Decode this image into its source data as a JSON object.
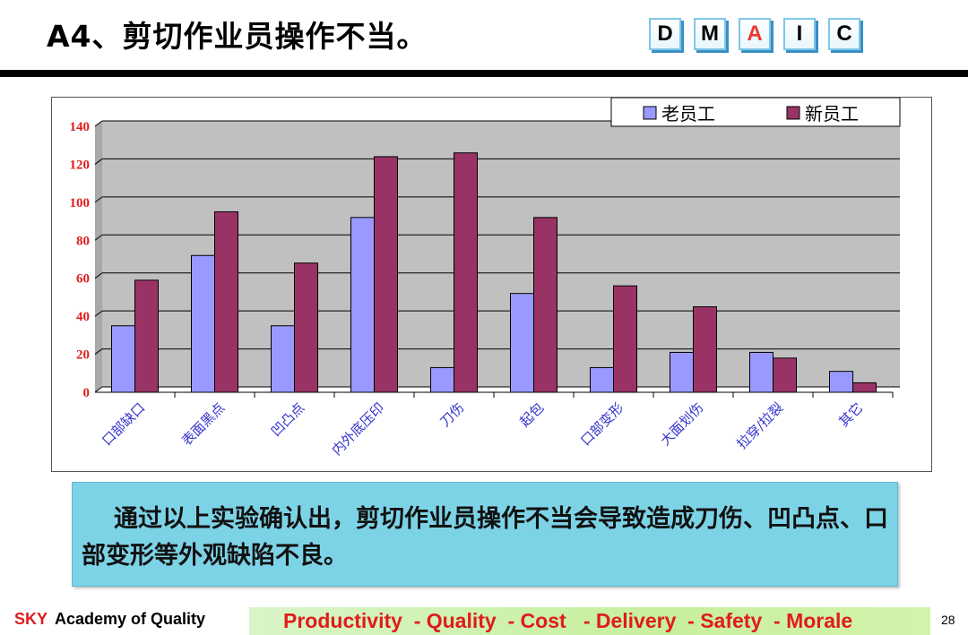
{
  "slide": {
    "title": "A4、剪切作业员操作不当。",
    "dmaic": [
      {
        "letter": "D",
        "active": false
      },
      {
        "letter": "M",
        "active": false
      },
      {
        "letter": "A",
        "active": true
      },
      {
        "letter": "I",
        "active": false
      },
      {
        "letter": "C",
        "active": false
      }
    ],
    "conclusion": "通过以上实验确认出，剪切作业员操作不当会导致造成刀伤、凹凸点、口部变形等外观缺陷不良。",
    "footer": {
      "brand_prefix": "SKY",
      "brand_name": "Academy of Quality",
      "motto": "Productivity  - Quality  - Cost   - Delivery  - Safety  - Morale",
      "page": "28"
    }
  },
  "colors": {
    "old_staff": "#9999ff",
    "new_staff": "#993366",
    "plot_bg": "#c0c0c0",
    "tick_label": "#e01c1c",
    "category_label": "#3333cc",
    "dmaic_active": "#e8392b"
  },
  "chart_data": {
    "type": "bar",
    "categories": [
      "口部缺口",
      "表面黑点",
      "凹凸点",
      "内外底压印",
      "刀伤",
      "起包",
      "口部变形",
      "大面划伤",
      "拉穿/拉裂",
      "其它"
    ],
    "series": [
      {
        "name": "老员工",
        "values": [
          35,
          72,
          35,
          92,
          13,
          52,
          13,
          21,
          21,
          11
        ]
      },
      {
        "name": "新员工",
        "values": [
          59,
          95,
          68,
          124,
          126,
          92,
          56,
          45,
          18,
          5
        ]
      }
    ],
    "ylim": [
      0,
      140
    ],
    "yticks": [
      0,
      20,
      40,
      60,
      80,
      100,
      120,
      140
    ],
    "grid": true,
    "legend": "top-right",
    "title": "",
    "xlabel": "",
    "ylabel": ""
  }
}
